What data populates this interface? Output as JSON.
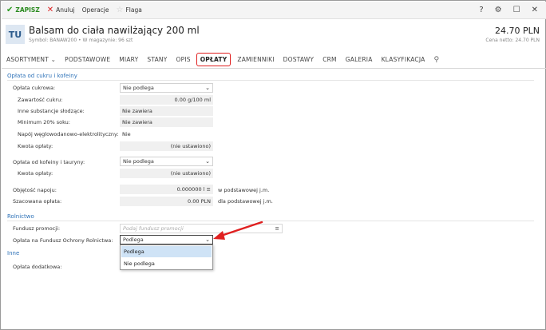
{
  "toolbar": {
    "save": "ZAPISZ",
    "cancel": "Anuluj",
    "operations": "Operacje",
    "flag": "Flaga",
    "help": "?",
    "settings": "⚙",
    "restore": "☐",
    "close": "✕"
  },
  "header": {
    "avatar": "TU",
    "title": "Balsam do ciała nawilżający 200 ml",
    "subtitle": "Symbol: BANAW200  •  W magazynie: 96 szt",
    "price": "24.70 PLN",
    "price_net": "Cena netto: 24.70 PLN"
  },
  "tabs": [
    "ASORTYMENT",
    "PODSTAWOWE",
    "MIARY",
    "STANY",
    "OPIS",
    "OPŁATY",
    "ZAMIENNIKI",
    "DOSTAWY",
    "CRM",
    "GALERIA",
    "KLASYFIKACJA"
  ],
  "tabs_chevron": "⌄",
  "active_tab": "OPŁATY",
  "sections": {
    "sugar": "Opłata od cukru i kofeiny",
    "agri": "Rolnictwo",
    "other": "Inne"
  },
  "fields": {
    "sugar_fee_label": "Opłata cukrowa:",
    "sugar_fee_value": "Nie podlega",
    "sugar_content_label": "Zawartość cukru:",
    "sugar_content_value": "0.00 g/100 ml",
    "other_sweet_label": "Inne substancje słodzące:",
    "other_sweet_value": "Nie zawiera",
    "juice_label": "Minimum 20% soku:",
    "juice_value": "Nie zawiera",
    "electrolyte_label": "Napój węglowodanowo-elektrolityczny:",
    "electrolyte_value": "Nie",
    "fee_amount_label": "Kwota opłaty:",
    "fee_amount_value": "(nie ustawiono)",
    "caffeine_label": "Opłata od kofeiny i tauryny:",
    "caffeine_value": "Nie podlega",
    "fee_amount2_label": "Kwota opłaty:",
    "fee_amount2_value": "(nie ustawiono)",
    "volume_label": "Objętość napoju:",
    "volume_value": "0.000000 l",
    "volume_unit": "w podstawowej j.m.",
    "estimated_label": "Szacowana opłata:",
    "estimated_value": "0.00 PLN",
    "estimated_unit": "dla podstawowej j.m.",
    "promo_label": "Fundusz promocji:",
    "promo_placeholder": "Podaj fundusz promocji",
    "agri_fee_label": "Opłata na Fundusz Ochrony Rolnictwa:",
    "agri_fee_value": "Podlega",
    "extra_fee_label": "Opłata dodatkowa:"
  },
  "dropdown_options": [
    "Podlega",
    "Nie podlega"
  ],
  "colors": {
    "accent": "#2e72b8",
    "highlight": "#e02020",
    "save": "#2a8a1f"
  }
}
